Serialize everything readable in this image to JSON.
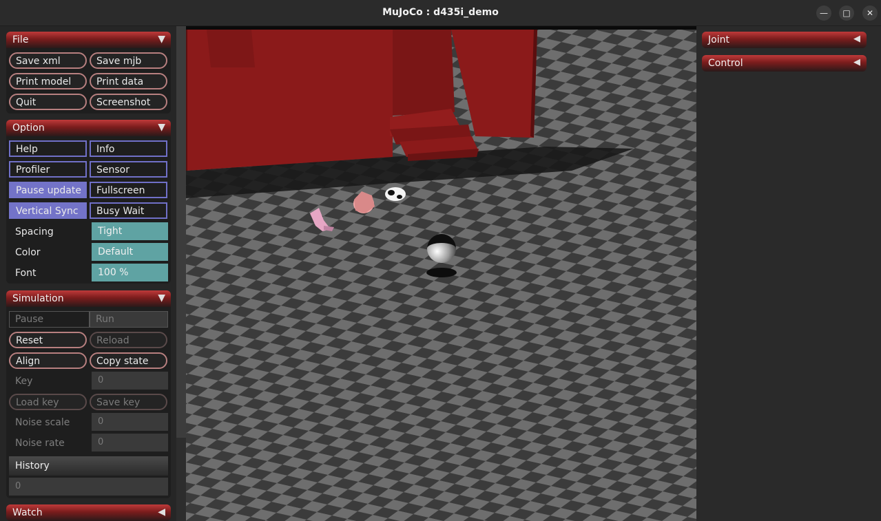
{
  "window": {
    "title": "MuJoCo : d435i_demo",
    "minimize_icon": "minimize-icon",
    "maximize_icon": "maximize-icon",
    "close_icon": "close-icon",
    "minimize_glyph": "—",
    "maximize_glyph": "□",
    "close_glyph": "✕"
  },
  "file": {
    "header": "File",
    "arrow": "▼",
    "save_xml": "Save xml",
    "save_mjb": "Save mjb",
    "print_model": "Print model",
    "print_data": "Print data",
    "quit": "Quit",
    "screenshot": "Screenshot"
  },
  "option": {
    "header": "Option",
    "arrow": "▼",
    "help": "Help",
    "info": "Info",
    "profiler": "Profiler",
    "sensor": "Sensor",
    "pause_update": "Pause update",
    "fullscreen": "Fullscreen",
    "vertical_sync": "Vertical Sync",
    "busy_wait": "Busy Wait",
    "spacing_label": "Spacing",
    "spacing_value": "Tight",
    "color_label": "Color",
    "color_value": "Default",
    "font_label": "Font",
    "font_value": "100 %"
  },
  "simulation": {
    "header": "Simulation",
    "arrow": "▼",
    "pause": "Pause",
    "run": "Run",
    "reset": "Reset",
    "reload": "Reload",
    "align": "Align",
    "copy_state": "Copy state",
    "key_label": "Key",
    "key_value": "0",
    "load_key": "Load key",
    "save_key": "Save key",
    "noise_scale_label": "Noise scale",
    "noise_scale_value": "0",
    "noise_rate_label": "Noise rate",
    "noise_rate_value": "0",
    "history_label": "History",
    "history_value": "0"
  },
  "watch": {
    "header": "Watch",
    "arrow": "◀"
  },
  "right": {
    "joint": "Joint",
    "joint_arrow": "◀",
    "control": "Control",
    "control_arrow": "◀"
  },
  "colors": {
    "header_red": "#bf3a3a",
    "toggle_on": "#7373c8",
    "select_teal": "#5fa3a3",
    "building_red": "#8b1a1a",
    "checker_light": "#6e6e6e",
    "checker_dark": "#3b3b3b"
  }
}
